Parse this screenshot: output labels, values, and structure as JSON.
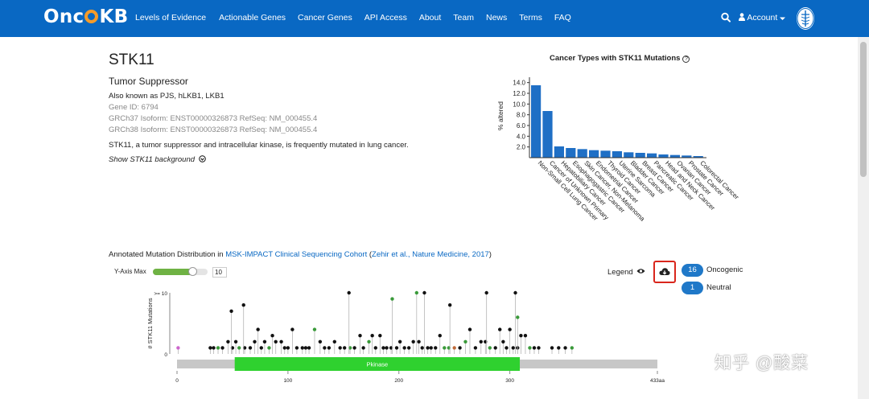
{
  "brand": {
    "logo_left": "Onc",
    "logo_right": "KB",
    "color": "#0968c3",
    "ring_color": "#f49b2a"
  },
  "nav": {
    "items": [
      {
        "label": "Levels of Evidence"
      },
      {
        "label": "Actionable Genes"
      },
      {
        "label": "Cancer Genes"
      },
      {
        "label": "API Access"
      },
      {
        "label": "About"
      },
      {
        "label": "Team"
      },
      {
        "label": "News"
      },
      {
        "label": "Terms"
      },
      {
        "label": "FAQ"
      }
    ],
    "account_label": "Account",
    "search_icon": "search-icon",
    "emblem_icon": "institution-emblem-icon"
  },
  "gene": {
    "symbol": "STK11",
    "type": "Tumor Suppressor",
    "aliases": "Also known as PJS, hLKB1, LKB1",
    "gene_id": "Gene ID: 6794",
    "grch37": "GRCh37  Isoform: ENST00000326873 RefSeq: NM_000455.4",
    "grch38": "GRCh38  Isoform: ENST00000326873 RefSeq: NM_000455.4",
    "summary": "STK11, a tumor suppressor and intracellular kinase, is frequently mutated in lung cancer.",
    "background_link": "Show STK11 background"
  },
  "chart_data": [
    {
      "type": "bar",
      "title": "Cancer Types with STK11 Mutations",
      "ylabel": "% altered",
      "ylim": [
        0,
        15
      ],
      "yticks": [
        "2.0",
        "4.0",
        "6.0",
        "8.0",
        "10.0",
        "12.0",
        "14.0"
      ],
      "color": "#1f6fc5",
      "categories": [
        "Non-Small Cell Lung Cancer",
        "Cancer of Unknown Primary",
        "Hepatobiliary Cancer",
        "Esophagogastric Cancer",
        "Skin Cancer, Non-Melanoma",
        "Endometrial Cancer",
        "Thyroid Cancer",
        "Uterine Sarcoma",
        "Bladder Cancer",
        "Breast Cancer",
        "Pancreatic Cancer",
        "Head and Neck Cancer",
        "Ovarian Cancer",
        "Prostate Cancer",
        "Colorectal Cancer"
      ],
      "values": [
        13.5,
        8.7,
        2.1,
        1.8,
        1.6,
        1.4,
        1.3,
        1.2,
        1.0,
        0.9,
        0.8,
        0.6,
        0.5,
        0.4,
        0.3
      ]
    },
    {
      "type": "scatter",
      "subtype": "lollipop",
      "ylabel": "# STK11 Mutations",
      "ytick_top": ">= 10",
      "ytick_bottom": "0",
      "ylim": [
        0,
        10
      ],
      "xlim": [
        0,
        433
      ],
      "xticks": [
        "0",
        "100",
        "200",
        "300",
        "433aa"
      ],
      "xtick_values": [
        0,
        100,
        200,
        300,
        433
      ],
      "domain": {
        "label": "Pkinase",
        "start": 52,
        "end": 309,
        "color": "#2fd12f"
      },
      "backbone_color": "#c7c7c7",
      "point_colors": {
        "missense": "#111111",
        "inframe": "#3a9a3a",
        "other": "#c06a3a",
        "splice": "#cc66cc"
      },
      "tall": [
        {
          "x": 49,
          "y": 7,
          "c": "missense"
        },
        {
          "x": 60,
          "y": 8,
          "c": "missense"
        },
        {
          "x": 155,
          "y": 10,
          "c": "missense"
        },
        {
          "x": 194,
          "y": 9,
          "c": "inframe"
        },
        {
          "x": 216,
          "y": 10,
          "c": "inframe"
        },
        {
          "x": 223,
          "y": 10,
          "c": "missense"
        },
        {
          "x": 246,
          "y": 8,
          "c": "missense"
        },
        {
          "x": 279,
          "y": 10,
          "c": "missense"
        },
        {
          "x": 305,
          "y": 10,
          "c": "missense"
        },
        {
          "x": 307,
          "y": 6,
          "c": "inframe"
        }
      ]
    }
  ],
  "mutation_section": {
    "prefix": "Annotated Mutation Distribution in ",
    "cohort_link": "MSK-IMPACT Clinical Sequencing Cohort",
    "open_paren": " (",
    "citation_link": "Zehir et al., Nature Medicine, 2017",
    "close_paren": ")",
    "y_axis_max_label": "Y-Axis Max",
    "y_axis_max_value": "10",
    "y_axis_max_fraction": 0.72,
    "legend_label": "Legend",
    "oncogenic_count": "16",
    "oncogenic_label": "Oncogenic",
    "neutral_count": "1",
    "neutral_label": "Neutral",
    "badge_color": "#1f78c8",
    "download_highlight_color": "#d9261c"
  },
  "watermark": "知乎 @酸菜"
}
